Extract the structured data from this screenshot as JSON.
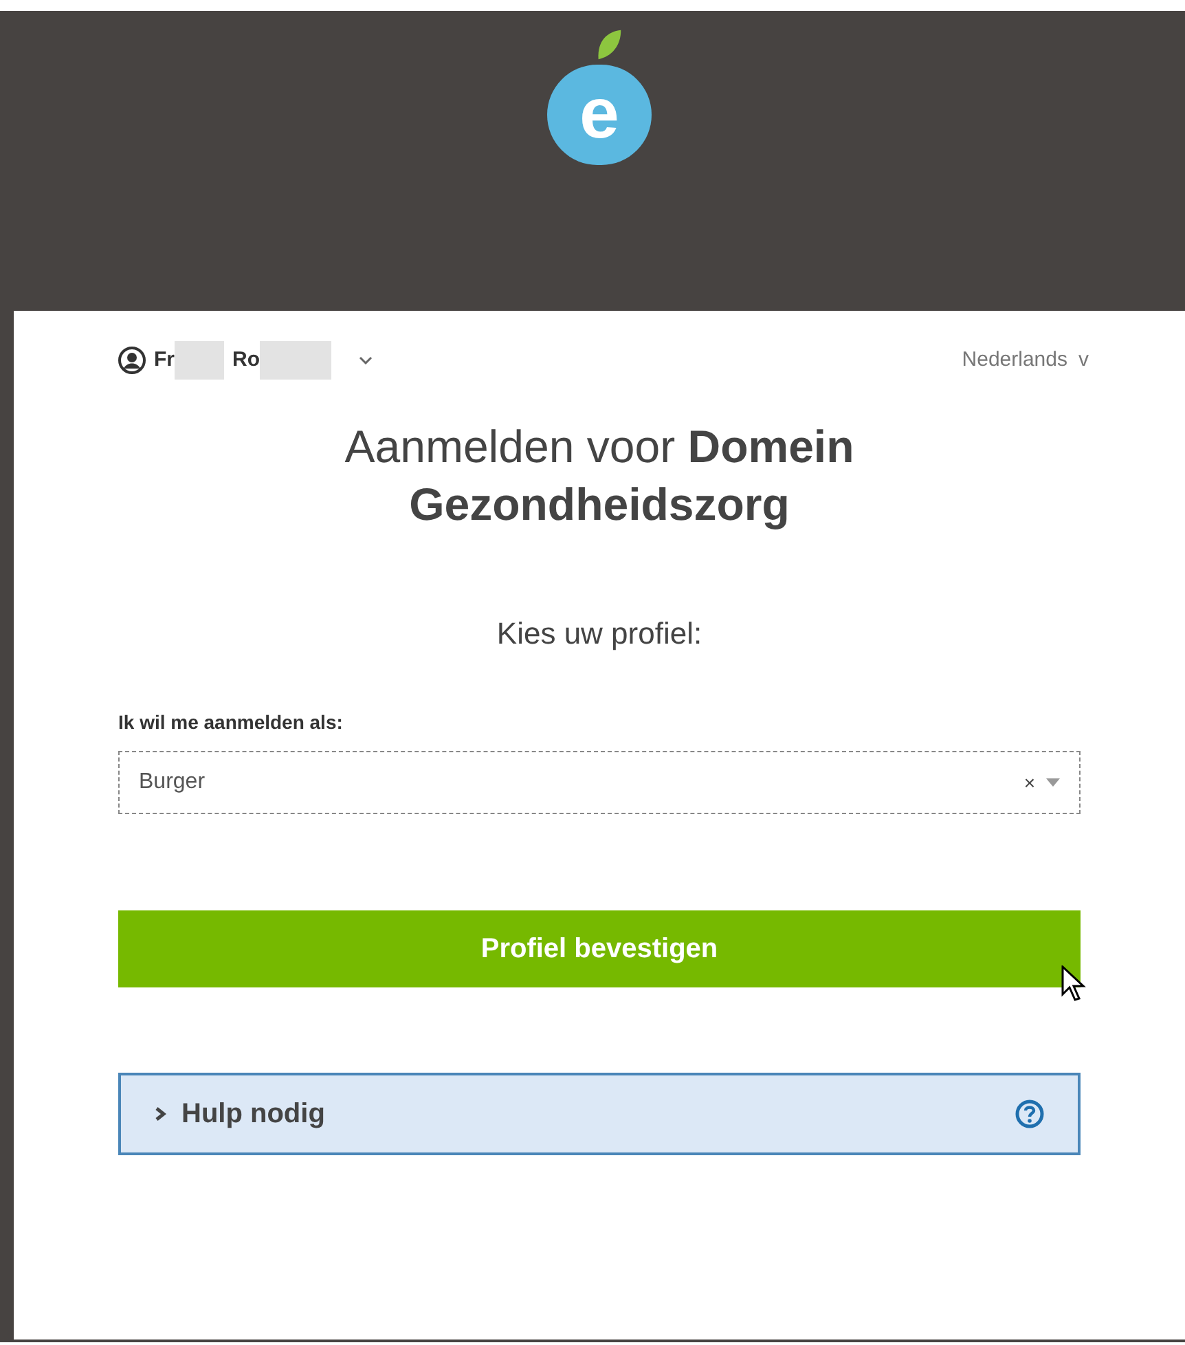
{
  "logo": {
    "letter": "e"
  },
  "user": {
    "name_parts": [
      "Fr",
      "Ro"
    ]
  },
  "language": {
    "label": "Nederlands",
    "caret": "v"
  },
  "heading": "Aanmelden voor **Domein Gezondheidszorg**",
  "subheading": "Kies uw profiel:",
  "profile_select": {
    "label": "Ik wil me aanmelden als:",
    "value": "Burger",
    "clear": "×"
  },
  "confirm_button": {
    "label": "Profiel bevestigen",
    "hovered": true
  },
  "help": {
    "label": "Hulp nodig",
    "expanded": false
  }
}
